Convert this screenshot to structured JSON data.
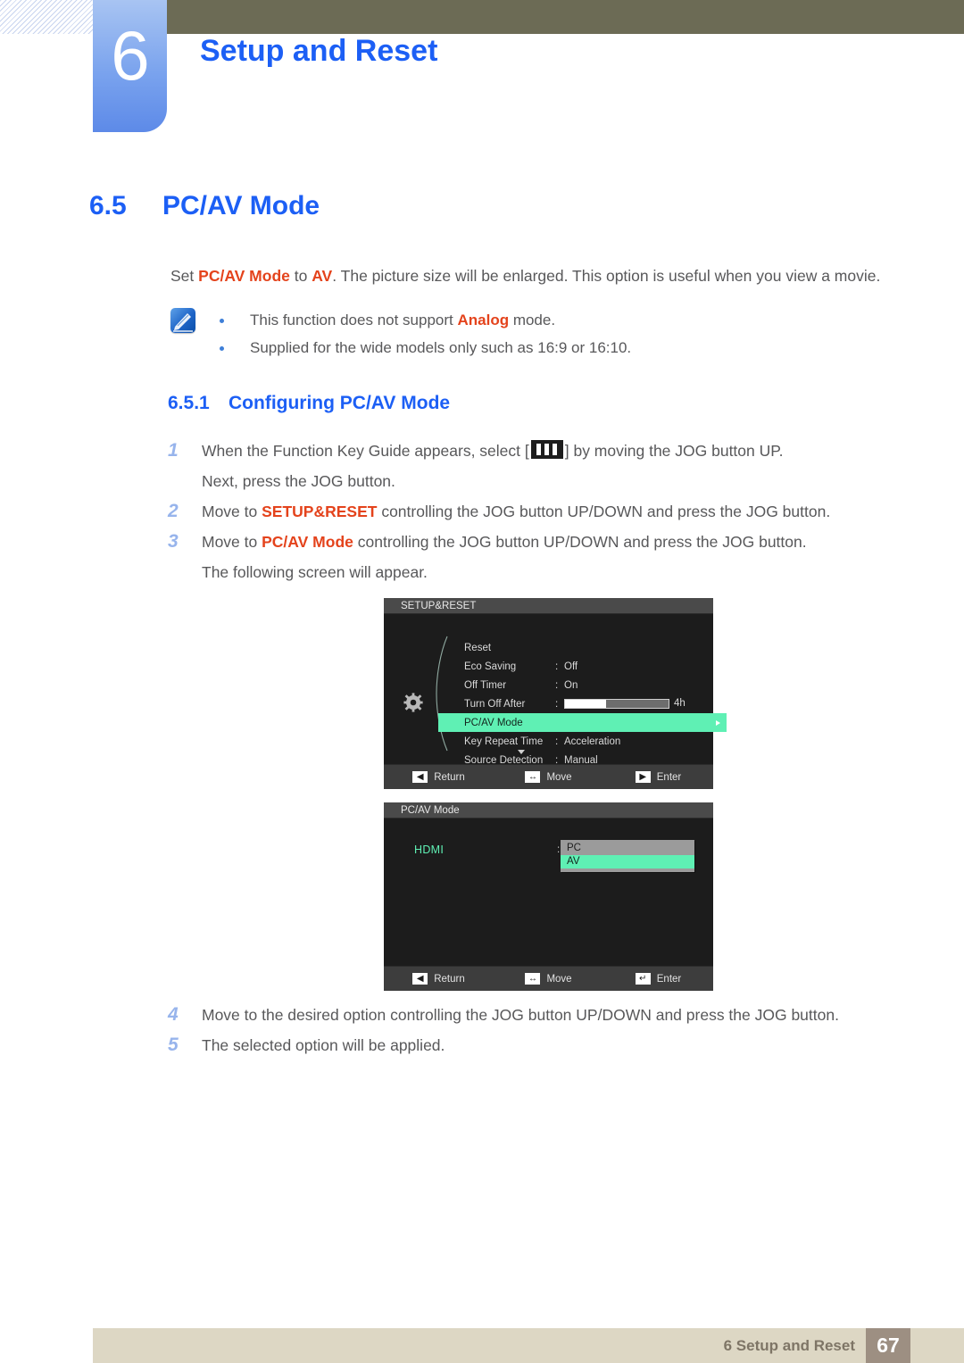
{
  "header": {
    "chapter_number": "6",
    "chapter_title": "Setup and Reset"
  },
  "section": {
    "number": "6.5",
    "title": "PC/AV Mode"
  },
  "intro": {
    "p1_a": "Set ",
    "p1_b": "PC/AV Mode",
    "p1_c": " to ",
    "p1_d": "AV",
    "p1_e": ". The picture size will be enlarged. This option is useful when you view a movie."
  },
  "notes": {
    "icon": "note-icon",
    "items": [
      {
        "a": "This function does not support ",
        "b": "Analog",
        "c": " mode."
      },
      {
        "a": "Supplied for the wide models only such as 16:9 or 16:10.",
        "b": "",
        "c": ""
      }
    ]
  },
  "subsection": {
    "number": "6.5.1",
    "title": "Configuring PC/AV Mode"
  },
  "steps": [
    {
      "index": "1",
      "line1_a": "When the Function Key Guide appears, select [",
      "line1_icon": "function-key-guide-icon",
      "line1_b": "] by moving the JOG button UP.",
      "line2": "Next, press the JOG button."
    },
    {
      "index": "2",
      "line1_a": "Move to ",
      "line1_highlight": "SETUP&RESET",
      "line1_b": " controlling the JOG button UP/DOWN and press the JOG button.",
      "line2": ""
    },
    {
      "index": "3",
      "line1_a": "Move to ",
      "line1_highlight": "PC/AV Mode",
      "line1_b": " controlling the JOG button UP/DOWN and press the JOG button.",
      "line2": "The following screen will appear."
    },
    {
      "index": "4",
      "line1_a": "Move to the desired option controlling the JOG button UP/DOWN and press the JOG button.",
      "line1_highlight": "",
      "line1_b": "",
      "line2": ""
    },
    {
      "index": "5",
      "line1_a": "The selected option will be applied.",
      "line1_highlight": "",
      "line1_b": "",
      "line2": ""
    }
  ],
  "osd1": {
    "title": "SETUP&RESET",
    "icon": "gear-icon",
    "rows": [
      {
        "label": "Reset",
        "colon": "",
        "value": "",
        "selected": false,
        "type": "text"
      },
      {
        "label": "Eco Saving",
        "colon": ":",
        "value": "Off",
        "selected": false,
        "type": "text"
      },
      {
        "label": "Off Timer",
        "colon": ":",
        "value": "On",
        "selected": false,
        "type": "text"
      },
      {
        "label": "Turn Off After",
        "colon": ":",
        "value": "4h",
        "selected": false,
        "type": "slider",
        "fill_percent": 40
      },
      {
        "label": "PC/AV Mode",
        "colon": "",
        "value": "",
        "selected": true,
        "type": "text"
      },
      {
        "label": "Key Repeat Time",
        "colon": ":",
        "value": "Acceleration",
        "selected": false,
        "type": "text"
      },
      {
        "label": "Source Detection",
        "colon": ":",
        "value": "Manual",
        "selected": false,
        "type": "text"
      }
    ],
    "footer": [
      {
        "glyph": "◀",
        "label": "Return",
        "icon": "left-arrow-icon"
      },
      {
        "glyph": "↔",
        "label": "Move",
        "icon": "move-arrows-icon"
      },
      {
        "glyph": "▶",
        "label": "Enter",
        "icon": "right-arrow-icon"
      }
    ]
  },
  "osd2": {
    "title": "PC/AV Mode",
    "source_label": "HDMI",
    "colon": ":",
    "options": [
      {
        "label": "PC",
        "selected": false
      },
      {
        "label": "AV",
        "selected": true
      }
    ],
    "footer": [
      {
        "glyph": "◀",
        "label": "Return",
        "icon": "left-arrow-icon"
      },
      {
        "glyph": "↔",
        "label": "Move",
        "icon": "move-arrows-icon"
      },
      {
        "glyph": "↵",
        "label": "Enter",
        "icon": "enter-arrow-icon"
      }
    ]
  },
  "footer": {
    "text": "6 Setup and Reset",
    "page_number": "67"
  },
  "colors": {
    "accent_blue": "#1c5ff5",
    "highlight_red": "#e4431c",
    "osd_green": "#5ff0b4",
    "header_olive": "#6c6b55",
    "footer_tan": "#ddd7c4",
    "page_chip": "#9d8f82"
  }
}
